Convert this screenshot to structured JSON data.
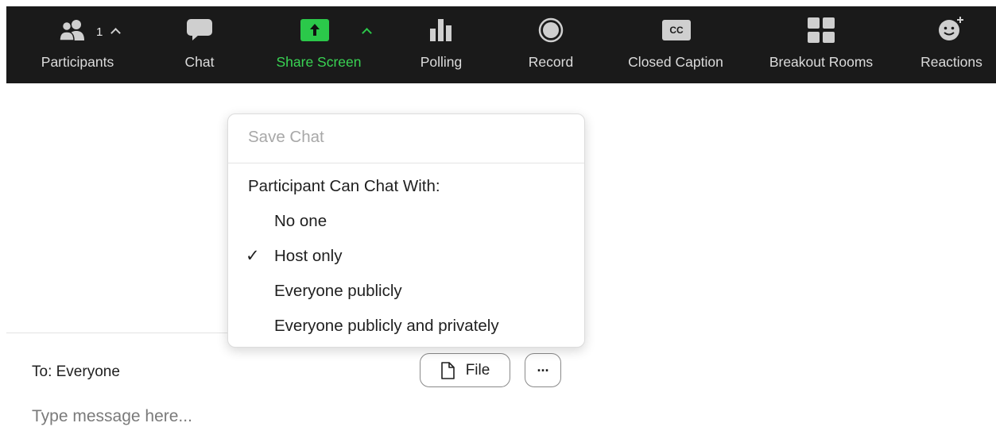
{
  "toolbar": {
    "participants": {
      "label": "Participants",
      "count": "1",
      "icon": "participants-icon"
    },
    "chat": {
      "label": "Chat",
      "icon": "chat-bubble-icon"
    },
    "share_screen": {
      "label": "Share Screen",
      "icon": "share-screen-icon",
      "color": "#39d353"
    },
    "polling": {
      "label": "Polling",
      "icon": "bar-chart-icon"
    },
    "record": {
      "label": "Record",
      "icon": "record-icon"
    },
    "closed_caption": {
      "label": "Closed Caption",
      "icon": "cc-icon",
      "icon_text": "CC"
    },
    "breakout_rooms": {
      "label": "Breakout Rooms",
      "icon": "grid-icon"
    },
    "reactions": {
      "label": "Reactions",
      "icon": "emoji-plus-icon"
    }
  },
  "menu": {
    "save_chat": "Save Chat",
    "header": "Participant Can Chat With:",
    "options": [
      {
        "label": "No one",
        "checked": false
      },
      {
        "label": "Host only",
        "checked": true
      },
      {
        "label": "Everyone publicly",
        "checked": false
      },
      {
        "label": "Everyone publicly and privately",
        "checked": false
      }
    ],
    "check_glyph": "✓"
  },
  "chat_panel": {
    "to_label": "To: Everyone",
    "file_button": "File",
    "more_button": "···",
    "message_placeholder": "Type message here..."
  }
}
